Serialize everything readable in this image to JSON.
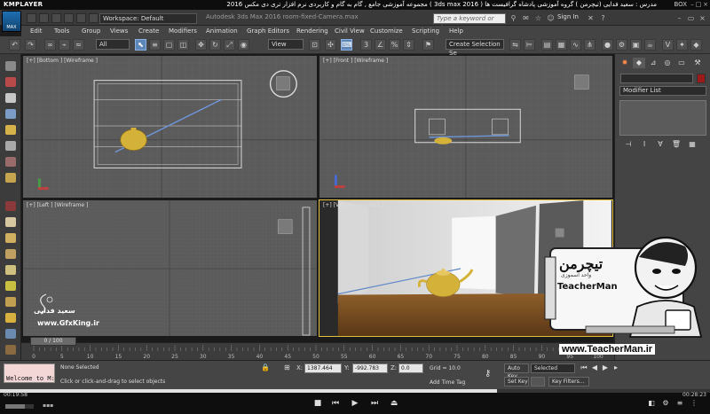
{
  "player": {
    "name": "KMPLAYER",
    "course_title": "مجموعه آموزشی جامع , گام به گام و کاربردی نرم افزار تری دی مکس 2016 ( 3ds max 2016 )  مدرس : سعید فدایی (تیچرمن ) گروه آموزشی پادشاه گرافیست ها",
    "box_label": "BOX",
    "time_elapsed": "00:19:58",
    "time_total": "00:28:23",
    "progress": 0.7
  },
  "max": {
    "logo": "MAX",
    "workspace": "Workspace: Default",
    "doc_title": "Autodesk 3ds Max 2016    room-fixed-Camera.max",
    "search_placeholder": "Type a keyword or phrase",
    "sign_in": "Sign In",
    "menus": [
      "Edit",
      "Tools",
      "Group",
      "Views",
      "Create",
      "Modifiers",
      "Animation",
      "Graph Editors",
      "Rendering",
      "Civil View",
      "Customize",
      "Scripting",
      "Help"
    ],
    "toolbar": {
      "filter": "All",
      "ref_coord": "View",
      "selection_set": "Create Selection Se"
    }
  },
  "viewports": {
    "top_left": "[+] [Bottom ] [Wireframe ]",
    "top_right": "[+] [Front ] [Wireframe ]",
    "bottom_left": "[+] [Left ] [Wireframe ]",
    "bottom_right": "[+] [VRayCamera001 ]"
  },
  "command_panel": {
    "modifier_list": "Modifier List"
  },
  "timeline": {
    "frame": "0 / 100",
    "ticks": [
      "0",
      "5",
      "10",
      "15",
      "20",
      "25",
      "30",
      "35",
      "40",
      "45",
      "50",
      "55",
      "60",
      "65",
      "70",
      "75",
      "80",
      "85",
      "90",
      "95",
      "100"
    ]
  },
  "status": {
    "maxscript": "Welcome to M:",
    "selection": "None Selected",
    "prompt": "Click or click-and-drag to select objects",
    "x_label": "X:",
    "x": "1387.464",
    "y_label": "Y:",
    "y": "-992.783",
    "z_label": "Z:",
    "z": "0.0",
    "grid": "Grid = 10.0",
    "auto_key": "Auto Key",
    "set_key": "Set Key",
    "key_mode": "Selected",
    "key_filters": "Key Filters...",
    "add_time_tag": "Add Time Tag"
  },
  "watermarks": {
    "teacher_name_fa": "تیچرمن",
    "teacher_subtitle_fa": "واحد اسموزی",
    "teacher_name_en": "TeacherMan",
    "teacher_url": "www.TeacherMan.ir",
    "author_fa": "سعید فدایی",
    "site": "www.GfxKing.ir"
  },
  "colors": {
    "viewport_bg": "#5b5b5b",
    "active_border": "#e0c040",
    "teapot": "#d4b23a",
    "accent_blue": "#5d86b8"
  }
}
